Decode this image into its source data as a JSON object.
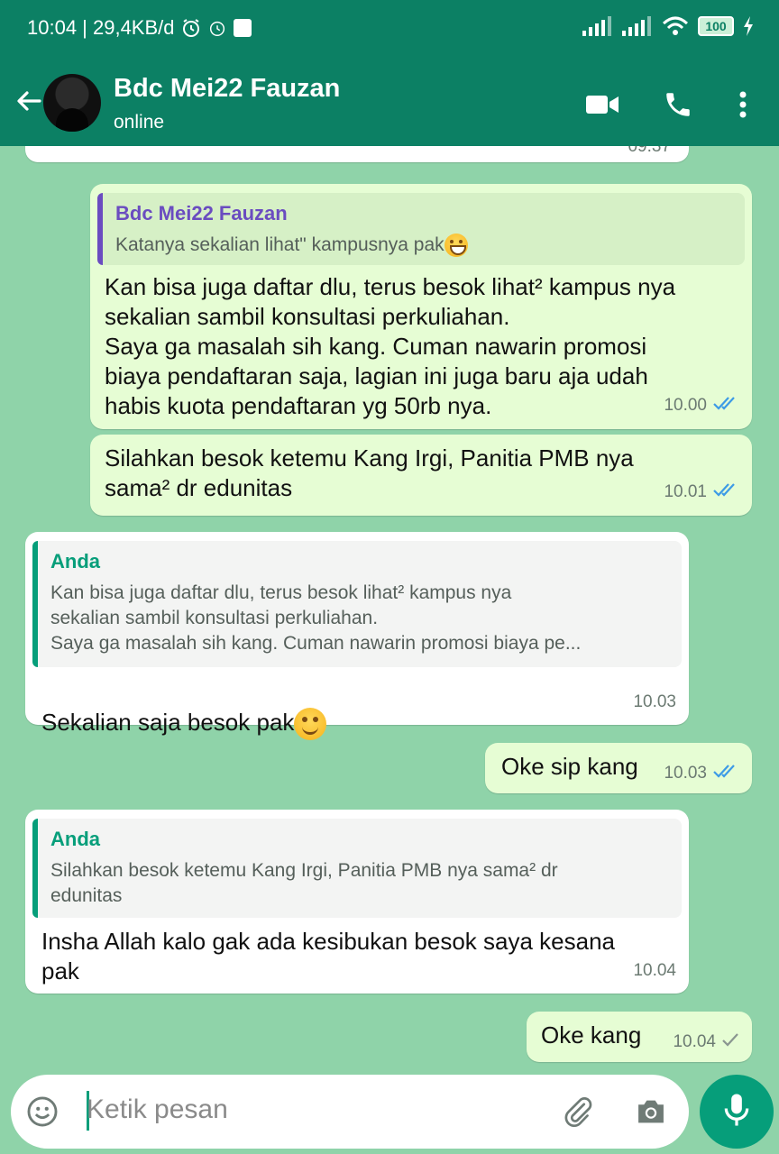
{
  "status_bar": {
    "time_info": "10:04 | 29,4KB/d",
    "battery": "100"
  },
  "header": {
    "contact_name": "Bdc Mei22 Fauzan",
    "contact_status": "online"
  },
  "messages": [
    {
      "id": "top-partial",
      "time": "09.37"
    },
    {
      "id": "m1",
      "direction": "out",
      "quote_author": "Bdc Mei22 Fauzan",
      "quote_text": "Katanya sekalian lihat\" kampusnya pak",
      "text": "Kan bisa juga daftar dlu, terus besok lihat² kampus nya\nsekalian sambil konsultasi perkuliahan.\nSaya ga masalah sih kang. Cuman nawarin promosi\nbiaya pendaftaran saja, lagian ini juga baru aja udah\nhabis kuota pendaftaran yg 50rb nya.",
      "time": "10.00",
      "ticks": "double-blue"
    },
    {
      "id": "m2",
      "direction": "out",
      "text": "Silahkan besok ketemu Kang Irgi, Panitia PMB nya\nsama² dr edunitas",
      "time": "10.01",
      "ticks": "double-blue"
    },
    {
      "id": "m3",
      "direction": "in",
      "quote_author": "Anda",
      "quote_text": "Kan bisa juga daftar dlu, terus besok lihat² kampus nya\nsekalian sambil konsultasi perkuliahan.\nSaya ga masalah sih kang. Cuman nawarin promosi biaya pe...",
      "text": "Sekalian saja besok pak",
      "time": "10.03"
    },
    {
      "id": "m4",
      "direction": "out",
      "text": "Oke sip kang",
      "time": "10.03",
      "ticks": "double-blue"
    },
    {
      "id": "m5",
      "direction": "in",
      "quote_author": "Anda",
      "quote_text": "Silahkan besok ketemu Kang Irgi, Panitia PMB nya sama² dr\nedunitas",
      "text": "Insha Allah kalo gak ada kesibukan besok saya kesana\npak",
      "time": "10.04"
    },
    {
      "id": "m6",
      "direction": "out",
      "text": "Oke kang",
      "time": "10.04",
      "ticks": "single-grey"
    }
  ],
  "composer": {
    "placeholder": "Ketik pesan"
  },
  "colors": {
    "header": "#0c8064",
    "chat_background": "#8fd3a9",
    "outgoing_bubble": "#e6fdd4",
    "incoming_bubble": "#ffffff",
    "read_ticks": "#3d9be6",
    "accent": "#069e7a"
  },
  "icons": [
    "back-arrow-icon",
    "video-call-icon",
    "phone-icon",
    "more-options-icon",
    "emoji-icon",
    "attach-icon",
    "camera-icon",
    "mic-icon"
  ]
}
